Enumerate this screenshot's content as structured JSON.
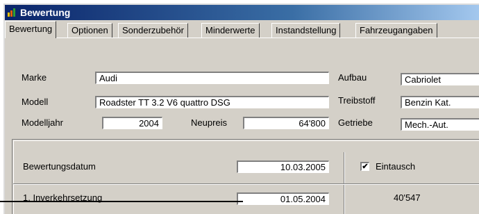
{
  "window": {
    "title": "Bewertung"
  },
  "tabs": [
    {
      "label": "Bewertung"
    },
    {
      "label": "Optionen"
    },
    {
      "label": "Sonderzubehör"
    },
    {
      "label": "Minderwerte"
    },
    {
      "label": "Instandstellung"
    },
    {
      "label": "Fahrzeugangaben"
    }
  ],
  "vehicle": {
    "marke_label": "Marke",
    "marke_value": "Audi",
    "modell_label": "Modell",
    "modell_value": "Roadster TT 3.2 V6 quattro DSG",
    "modelljahr_label": "Modelljahr",
    "modelljahr_value": "2004",
    "neupreis_label": "Neupreis",
    "neupreis_value": "64'800",
    "aufbau_label": "Aufbau",
    "aufbau_value": "Cabriolet",
    "treibstoff_label": "Treibstoff",
    "treibstoff_value": "Benzin Kat.",
    "getriebe_label": "Getriebe",
    "getriebe_value": "Mech.-Aut."
  },
  "valuation": {
    "datum_label": "Bewertungsdatum",
    "datum_value": "10.03.2005",
    "eintausch_label": "Eintausch",
    "eintausch_checked": true,
    "eintausch_mark": "✔",
    "inverkehr_label": "1. Inverkehrsetzung",
    "inverkehr_value": "01.05.2004",
    "result_value": "40'547"
  }
}
